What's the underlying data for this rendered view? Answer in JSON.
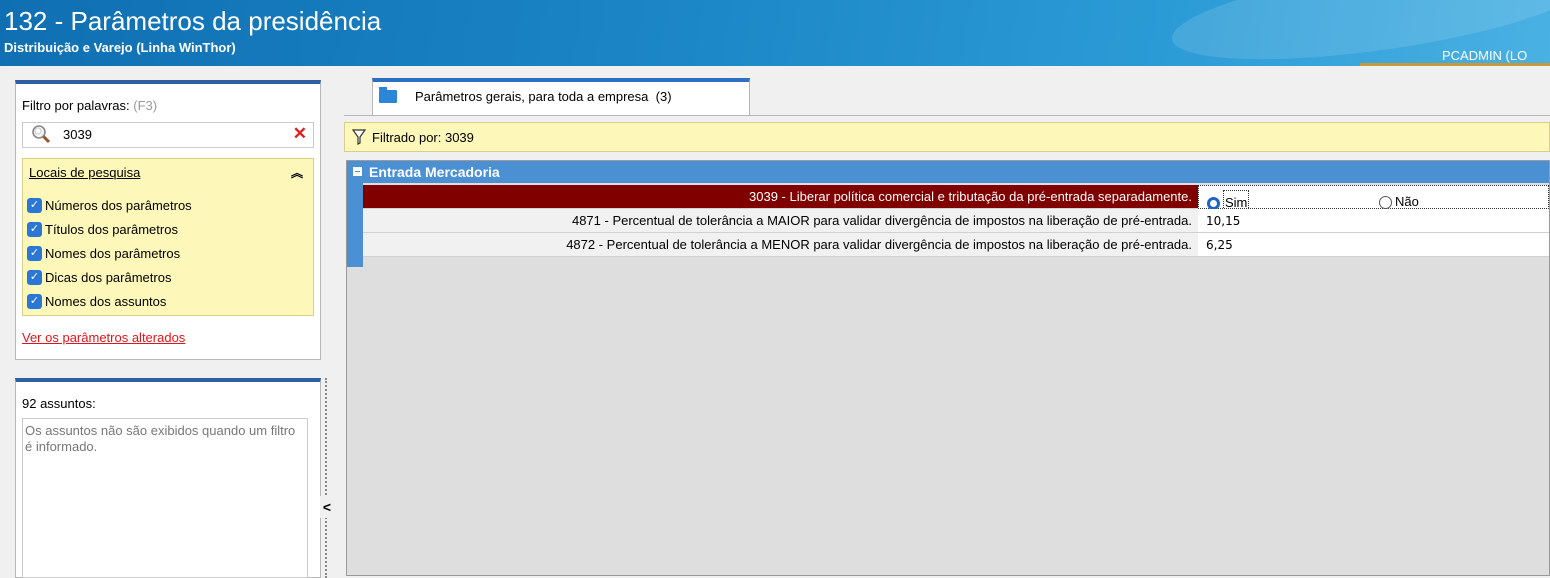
{
  "header": {
    "title": "132 - Parâmetros da presidência",
    "subtitle": "Distribuição e Varejo (Linha WinThor)",
    "user": "PCADMIN (LO"
  },
  "filter_panel": {
    "label": "Filtro por palavras:",
    "shortcut": "(F3)",
    "search_value": "3039",
    "locais_title": "Locais de pesquisa",
    "options": [
      {
        "label": "Números dos parâmetros",
        "checked": true
      },
      {
        "label": "Títulos dos parâmetros",
        "checked": true
      },
      {
        "label": "Nomes dos parâmetros",
        "checked": true
      },
      {
        "label": "Dicas dos parâmetros",
        "checked": true
      },
      {
        "label": "Nomes dos assuntos",
        "checked": true
      }
    ],
    "changed_link": "Ver os parâmetros alterados"
  },
  "subjects_panel": {
    "count_label": "92 assuntos:",
    "note": "Os assuntos não são exibidos quando um filtro é informado."
  },
  "tab": {
    "label": "Parâmetros gerais, para toda a empresa",
    "count": "(3)"
  },
  "filter_bar": {
    "text": "Filtrado por: 3039"
  },
  "grid": {
    "group": "Entrada Mercadoria",
    "rows": [
      {
        "name": "3039 - Liberar política comercial e tributação da pré-entrada separadamente.",
        "type": "radio",
        "options": [
          "Sim",
          "Não"
        ],
        "selected": "Sim"
      },
      {
        "name": "4871 - Percentual de tolerância a MAIOR para validar divergência de impostos na liberação de pré-entrada.",
        "value": "10,15"
      },
      {
        "name": "4872 - Percentual de tolerância a MENOR para validar divergência de impostos na liberação de pré-entrada.",
        "value": "6,25"
      }
    ]
  },
  "colors": {
    "header_blue": "#1a84c4",
    "selected_row": "#800000",
    "group_header": "#4a90d3",
    "filter_yellow": "#fdf8b9",
    "link_red": "#e0161b"
  }
}
